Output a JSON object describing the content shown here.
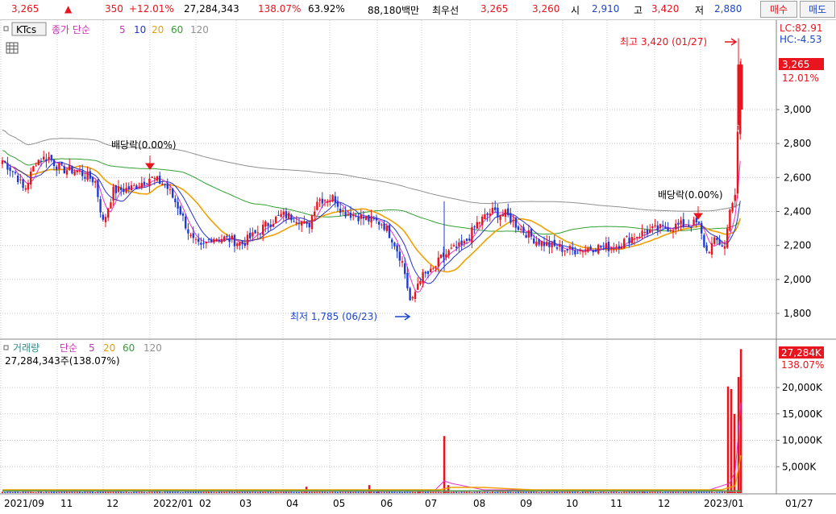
{
  "header": {
    "price": "3,265",
    "up_arrow": "▲",
    "change": "350",
    "change_pct": "+12.01%",
    "volume": "27,284,343",
    "volume_ratio": "138.07%",
    "turnover": "63.92%",
    "amount": "88,180백만",
    "bid_label": "최우선",
    "ask_price": "3,265",
    "bid_price": "3,260",
    "open_label": "시",
    "open": "2,910",
    "high_label": "고",
    "high": "3,420",
    "low_label": "저",
    "low": "2,880",
    "buy_button": "매수",
    "sell_button": "매도"
  },
  "price_pane": {
    "code_label": "KTcs",
    "legend_title": "종가 단순",
    "ma_periods": [
      "5",
      "10",
      "20",
      "60",
      "120"
    ],
    "lc": "LC:82.91",
    "hc": "HC:-4.53",
    "current_price": "3,265",
    "current_pct": "12.01%",
    "y_ticks": [
      "3,000",
      "2,800",
      "2,600",
      "2,400",
      "2,200",
      "2,000",
      "1,800"
    ],
    "dividend_label_1": "배당락(0.00%)",
    "dividend_label_2": "배당락(0.00%)",
    "max_label": "최고 3,420 (01/27)",
    "min_label": "최저 1,785 (06/23)"
  },
  "volume_pane": {
    "legend_title": "거래량",
    "legend_sub": "단순",
    "ma_periods": [
      "5",
      "20",
      "60",
      "120"
    ],
    "value_label": "27,284,343주(138.07%)",
    "current_volume": "27,284K",
    "current_pct": "138.07%",
    "y_ticks": [
      "20,000K",
      "15,000K",
      "10,000K",
      "5,000K"
    ]
  },
  "x_axis": {
    "labels": [
      "2021/09",
      "11",
      "12",
      "2022/01",
      "02",
      "03",
      "04",
      "05",
      "06",
      "07",
      "08",
      "09",
      "10",
      "11",
      "12",
      "2023/01"
    ],
    "last_date": "01/27"
  },
  "colors": {
    "up": "#e8141e",
    "down": "#1e3cd2",
    "ma5": "#e632c8",
    "ma10": "#2832c8",
    "ma20": "#f0a000",
    "ma60": "#32a032",
    "ma120": "#909090",
    "grid": "#c8c8c8"
  },
  "chart_data": {
    "type": "line",
    "title": "KTcs",
    "x": [
      "2021/09",
      "11",
      "12",
      "2022/01",
      "02",
      "03",
      "04",
      "05",
      "06",
      "07",
      "08",
      "09",
      "10",
      "11",
      "12",
      "2023/01"
    ],
    "series": [
      {
        "name": "종가",
        "values": [
          2700,
          2650,
          2500,
          2600,
          2300,
          2200,
          2350,
          2450,
          2300,
          2000,
          2200,
          2400,
          2200,
          2150,
          2300,
          3265
        ]
      }
    ],
    "ylim": [
      1700,
      3500
    ],
    "ylabel": "",
    "xlabel": "",
    "high": {
      "value": 3420,
      "date": "01/27"
    },
    "low": {
      "value": 1785,
      "date": "06/23"
    },
    "volume_ylim": [
      0,
      27284
    ],
    "volume_last_k": 27284
  }
}
